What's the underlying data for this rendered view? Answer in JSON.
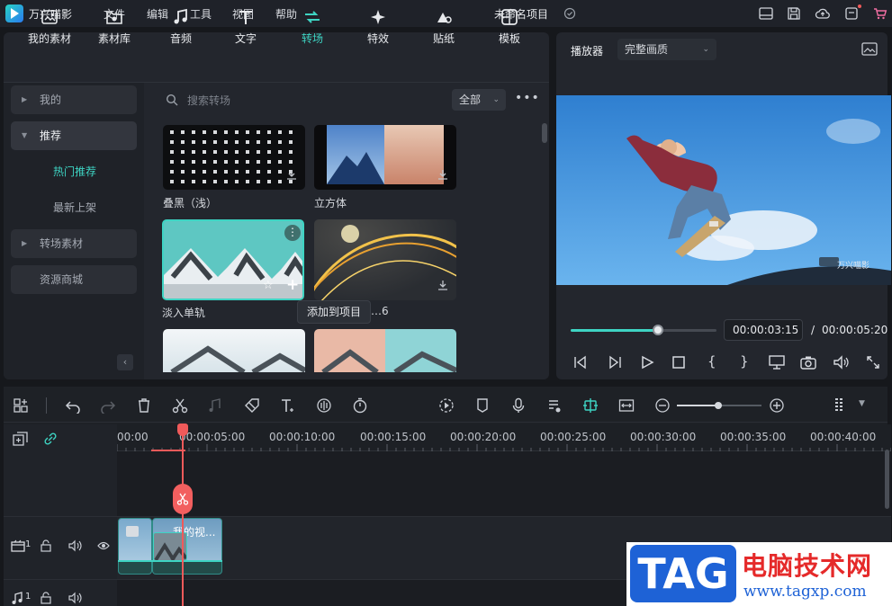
{
  "app": {
    "name": "万兴喵影",
    "menus": [
      "文件",
      "编辑",
      "工具",
      "视图",
      "帮助"
    ],
    "project_title": "未命名项目"
  },
  "tabs": [
    {
      "label": "我的素材",
      "icon": "folder-icon"
    },
    {
      "label": "素材库",
      "icon": "library-icon"
    },
    {
      "label": "音频",
      "icon": "music-note-icon"
    },
    {
      "label": "文字",
      "icon": "text-icon"
    },
    {
      "label": "转场",
      "icon": "transition-icon",
      "active": true
    },
    {
      "label": "特效",
      "icon": "sparkle-icon"
    },
    {
      "label": "贴纸",
      "icon": "sticker-icon"
    },
    {
      "label": "模板",
      "icon": "template-icon"
    }
  ],
  "sidebar": {
    "mine": "我的",
    "recommend": "推荐",
    "hot": "热门推荐",
    "newest": "最新上架",
    "material": "转场素材",
    "store": "资源商城"
  },
  "search": {
    "placeholder": "搜索转场",
    "filter": "全部"
  },
  "items": [
    {
      "label": "叠黑（浅）"
    },
    {
      "label": "立方体"
    },
    {
      "label": "淡入单轨"
    },
    {
      "label": "…6"
    }
  ],
  "tooltip": "添加到项目",
  "player": {
    "label": "播放器",
    "quality": "完整画质",
    "current": "00:00:03:15",
    "separator": "/",
    "total": "00:00:05:20",
    "progress": 0.6,
    "watermark": "万兴喵影"
  },
  "ruler": [
    "00:00",
    "00:00:05:00",
    "00:00:10:00",
    "00:00:15:00",
    "00:00:20:00",
    "00:00:25:00",
    "00:00:30:00",
    "00:00:35:00",
    "00:00:40:00"
  ],
  "tracks": {
    "video_index": "1",
    "audio_index": "1",
    "clip_title": "我的视..."
  },
  "brand": {
    "badge": "TAG",
    "title": "电脑技术网",
    "url": "www.tagxp.com"
  },
  "colors": {
    "accent": "#3ed4c3",
    "playhead": "#f05a5a"
  }
}
